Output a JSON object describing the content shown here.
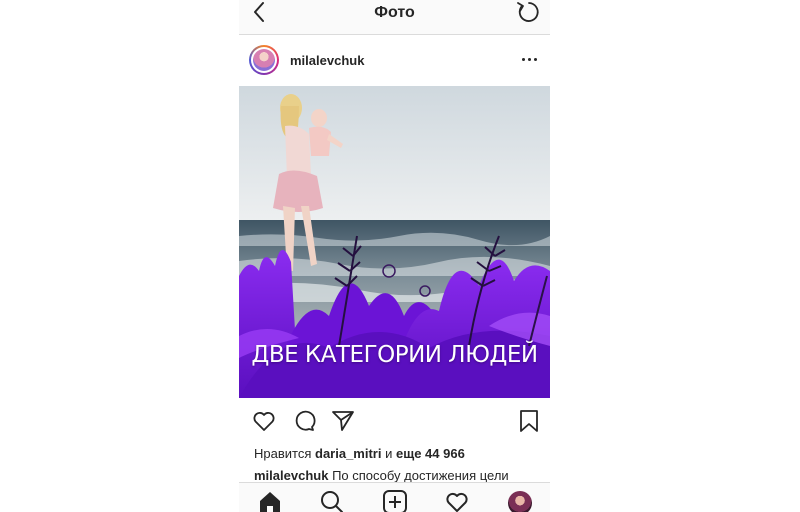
{
  "nav": {
    "title": "Фото",
    "back_icon": "chevron-left-icon",
    "refresh_icon": "refresh-icon"
  },
  "post": {
    "username": "milalevchuk",
    "more_icon": "more-horizontal-icon",
    "image_text": "ДВЕ КАТЕГОРИИ ЛЮДЕЙ",
    "accent_color": "#7a1fe6"
  },
  "actions": {
    "like_icon": "heart-icon",
    "comment_icon": "comment-icon",
    "share_icon": "send-icon",
    "save_icon": "bookmark-icon"
  },
  "likes": {
    "prefix": "Нравится",
    "user": "daria_mitri",
    "connector": "и",
    "more": "еще 44 966"
  },
  "caption": {
    "user": "milalevchuk",
    "text": "По способу достижения цели"
  },
  "tabbar": {
    "items": [
      "home-icon",
      "search-icon",
      "add-icon",
      "activity-icon",
      "profile-avatar"
    ]
  }
}
